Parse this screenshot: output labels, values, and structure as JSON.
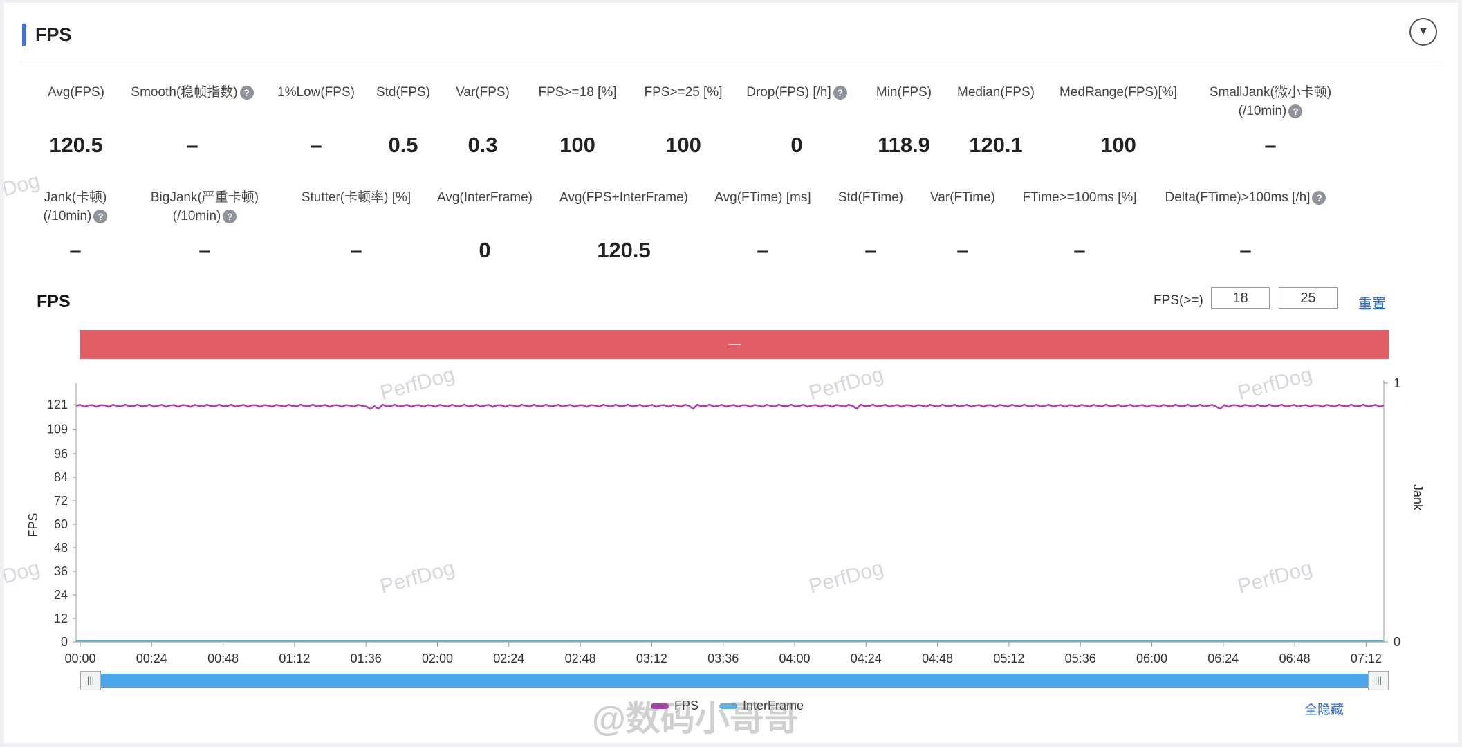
{
  "header": {
    "title": "FPS"
  },
  "metrics_row1": [
    {
      "label": "Avg(FPS)",
      "value": "120.5",
      "help": false
    },
    {
      "label": "Smooth(稳帧指数)",
      "value": "–",
      "help": true
    },
    {
      "label": "1%Low(FPS)",
      "value": "–",
      "help": false
    },
    {
      "label": "Std(FPS)",
      "value": "0.5",
      "help": false
    },
    {
      "label": "Var(FPS)",
      "value": "0.3",
      "help": false
    },
    {
      "label": "FPS>=18 [%]",
      "value": "100",
      "help": false
    },
    {
      "label": "FPS>=25 [%]",
      "value": "100",
      "help": false
    },
    {
      "label": "Drop(FPS) [/h]",
      "value": "0",
      "help": true
    },
    {
      "label": "Min(FPS)",
      "value": "118.9",
      "help": false
    },
    {
      "label": "Median(FPS)",
      "value": "120.1",
      "help": false
    },
    {
      "label": "MedRange(FPS)[%]",
      "value": "100",
      "help": false
    },
    {
      "label": "SmallJank(微小卡顿)",
      "label2": "(/10min)",
      "value": "–",
      "help": true
    }
  ],
  "metrics_row2": [
    {
      "label": "Jank(卡顿)",
      "label2": "(/10min)",
      "value": "–",
      "help": true
    },
    {
      "label": "BigJank(严重卡顿)",
      "label2": "(/10min)",
      "value": "–",
      "help": true
    },
    {
      "label": "Stutter(卡顿率) [%]",
      "value": "–",
      "help": false
    },
    {
      "label": "Avg(InterFrame)",
      "value": "0",
      "help": false
    },
    {
      "label": "Avg(FPS+InterFrame)",
      "value": "120.5",
      "help": false
    },
    {
      "label": "Avg(FTime) [ms]",
      "value": "–",
      "help": false
    },
    {
      "label": "Std(FTime)",
      "value": "–",
      "help": false
    },
    {
      "label": "Var(FTime)",
      "value": "–",
      "help": false
    },
    {
      "label": "FTime>=100ms [%]",
      "value": "–",
      "help": false
    },
    {
      "label": "Delta(FTime)>100ms [/h]",
      "value": "–",
      "help": true
    }
  ],
  "chart_section": {
    "title": "FPS",
    "threshold_label": "FPS(>=)",
    "threshold_low": "18",
    "threshold_high": "25",
    "reset_label": "重置",
    "band_text": "—",
    "hide_all_label": "全隐藏",
    "watermark": "PerfDog",
    "weibo_mark": "@数码小哥哥"
  },
  "chart_data": {
    "type": "line",
    "ylabel": "FPS",
    "y2label": "Jank",
    "yticks": [
      "0",
      "12",
      "24",
      "36",
      "48",
      "60",
      "72",
      "84",
      "96",
      "109",
      "121"
    ],
    "y2ticks": [
      "0",
      "1"
    ],
    "ylim": [
      0,
      132
    ],
    "x": [
      "00:00",
      "00:24",
      "00:48",
      "01:12",
      "01:36",
      "02:00",
      "02:24",
      "02:48",
      "03:12",
      "03:36",
      "04:00",
      "04:24",
      "04:48",
      "05:12",
      "05:36",
      "06:00",
      "06:24",
      "06:48",
      "07:12"
    ],
    "series": [
      {
        "name": "FPS",
        "color": "#b03ab4",
        "value_mean": 120.5,
        "value_min": 118.9,
        "value_max": 121.2
      },
      {
        "name": "InterFrame",
        "color": "#5ab4e8",
        "value_mean": 0
      }
    ],
    "grid": false
  }
}
